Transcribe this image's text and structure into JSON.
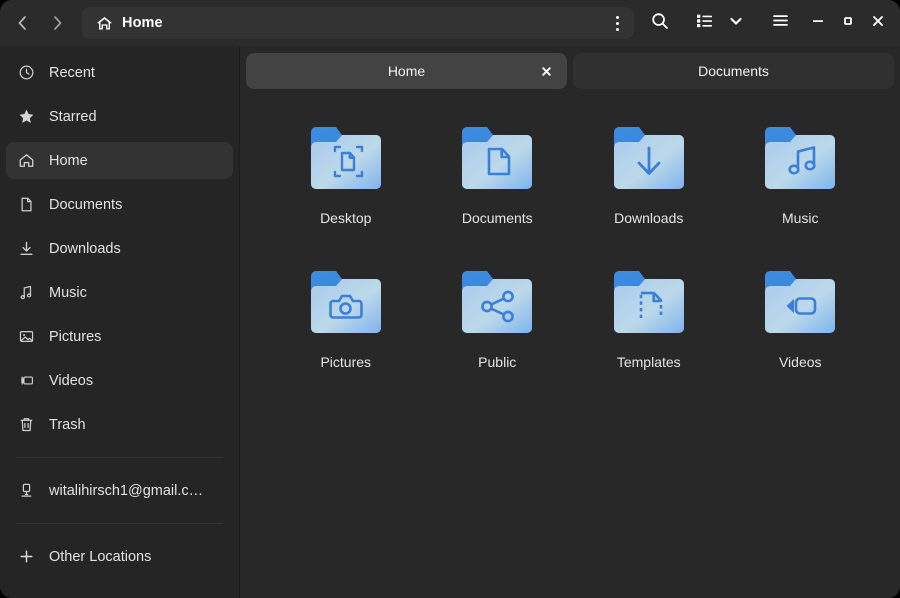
{
  "window": {
    "title": "Home",
    "accent": "#3584e4",
    "bg": "#282828",
    "sidebar_bg": "#252525",
    "header_bg": "#2b2b2b"
  },
  "header": {
    "back_icon": "chevron-left-icon",
    "forward_icon": "chevron-right-icon",
    "path_icon": "home-icon",
    "path_label": "Home",
    "path_menu_icon": "kebab-menu-icon",
    "search_icon": "search-icon",
    "view_list_icon": "list-view-icon",
    "view_dropdown_icon": "chevron-down-icon",
    "main_menu_icon": "hamburger-menu-icon",
    "minimize_icon": "minimize-icon",
    "maximize_icon": "maximize-icon",
    "close_icon": "close-icon"
  },
  "sidebar": {
    "items": [
      {
        "label": "Recent",
        "icon": "clock-icon",
        "selected": false
      },
      {
        "label": "Starred",
        "icon": "star-icon",
        "selected": false
      },
      {
        "label": "Home",
        "icon": "home-icon",
        "selected": true
      },
      {
        "label": "Documents",
        "icon": "document-icon",
        "selected": false
      },
      {
        "label": "Downloads",
        "icon": "download-icon",
        "selected": false
      },
      {
        "label": "Music",
        "icon": "music-note-icon",
        "selected": false
      },
      {
        "label": "Pictures",
        "icon": "image-icon",
        "selected": false
      },
      {
        "label": "Videos",
        "icon": "video-camera-icon",
        "selected": false
      },
      {
        "label": "Trash",
        "icon": "trash-icon",
        "selected": false
      }
    ],
    "account": {
      "label": "witalihirsch1@gmail.c…",
      "icon": "network-drive-icon"
    },
    "other_locations": {
      "label": "Other Locations",
      "icon": "plus-icon"
    }
  },
  "tabs": [
    {
      "label": "Home",
      "active": true,
      "closable": true,
      "close_icon": "close-icon"
    },
    {
      "label": "Documents",
      "active": false,
      "closable": false
    }
  ],
  "files": [
    {
      "name": "Desktop",
      "emblem": "desktop-emblem"
    },
    {
      "name": "Documents",
      "emblem": "document-emblem"
    },
    {
      "name": "Downloads",
      "emblem": "download-emblem"
    },
    {
      "name": "Music",
      "emblem": "music-emblem"
    },
    {
      "name": "Pictures",
      "emblem": "camera-emblem"
    },
    {
      "name": "Public",
      "emblem": "share-emblem"
    },
    {
      "name": "Templates",
      "emblem": "template-emblem"
    },
    {
      "name": "Videos",
      "emblem": "video-emblem"
    }
  ]
}
